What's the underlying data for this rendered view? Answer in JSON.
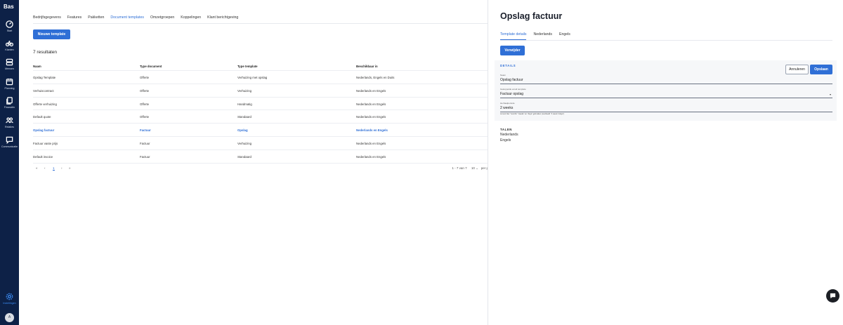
{
  "sidebar": {
    "logo": "Bas",
    "items": [
      {
        "label": "Start",
        "icon": "dashboard-icon"
      },
      {
        "label": "Klanten",
        "icon": "bicycle-icon"
      },
      {
        "label": "Mensen",
        "icon": "people-icon"
      },
      {
        "label": "Planning",
        "icon": "calendar-icon"
      },
      {
        "label": "Financiën",
        "icon": "documents-icon"
      },
      {
        "label": "Relaties",
        "icon": "relations-icon"
      },
      {
        "label": "Communicatie",
        "icon": "chat-bubble-icon"
      }
    ],
    "settings": {
      "label": "Instellingen",
      "icon": "gear-icon"
    },
    "avatar": "A"
  },
  "main": {
    "tabs": [
      "Bedrijfsgegevens",
      "Features",
      "Pakketten",
      "Document templates",
      "Omzetgroepen",
      "Koppelingen",
      "Klant berichtgeving"
    ],
    "active_tab": "Document templates",
    "new_button": "Nieuwe template",
    "results": "7 resultaten",
    "table": {
      "columns": [
        "Naam",
        "Type document",
        "Type template",
        "Beschikbaar in"
      ],
      "rows": [
        [
          "Opslag Template",
          "Offerte",
          "Verhuizing met opslag",
          "Nederlands, Engels en Duits"
        ],
        [
          "Verhuiscontract",
          "Offerte",
          "Verhuizing",
          "Nederlands en Engels"
        ],
        [
          "Offerte verhuizing",
          "Offerte",
          "Handmatig",
          "Nederlands en Engels"
        ],
        [
          "Default quote",
          "Offerte",
          "Standaard",
          "Nederlands en Engels"
        ],
        [
          "Opslag factuur",
          "Factuur",
          "Opslag",
          "Nederlands en Engels"
        ],
        [
          "Factuur vaste prijs",
          "Factuur",
          "Verhuizing",
          "Nederlands en Engels"
        ],
        [
          "Default invoice",
          "Factuur",
          "Standaard",
          "Nederlands en Engels"
        ]
      ],
      "selected_row": 4
    },
    "pagination": {
      "first": "«",
      "prev": "‹",
      "current_page": "1",
      "next": "›",
      "last": "»",
      "range": "1 - 7 van 7",
      "per_page": "10",
      "per_page_label": "per pagina"
    }
  },
  "panel": {
    "title": "Opslag factuur",
    "tabs": [
      "Template details",
      "Nederlands",
      "Engels"
    ],
    "active_tab": "Template details",
    "delete_button": "Verwijder",
    "details": {
      "title": "DETAILS",
      "cancel_button": "Annuleren",
      "save_button": "Opslaan",
      "fields": [
        {
          "label": "Naam",
          "value": "Opslag factuur"
        },
        {
          "label": "Gekoppelde email template",
          "value": "Factuur opslag"
        },
        {
          "label": "Herhaalperiode",
          "value": "2 weeks"
        }
      ],
      "hint": "Je kunt hier \"months\" \"weeks\" en \"days\" gebruiken (voorbeeld \"1 week 3 days\")"
    },
    "talen": {
      "title": "TALEN",
      "languages": [
        "Nederlands",
        "Engels"
      ]
    }
  },
  "chat_launcher_icon": "chat-icon"
}
